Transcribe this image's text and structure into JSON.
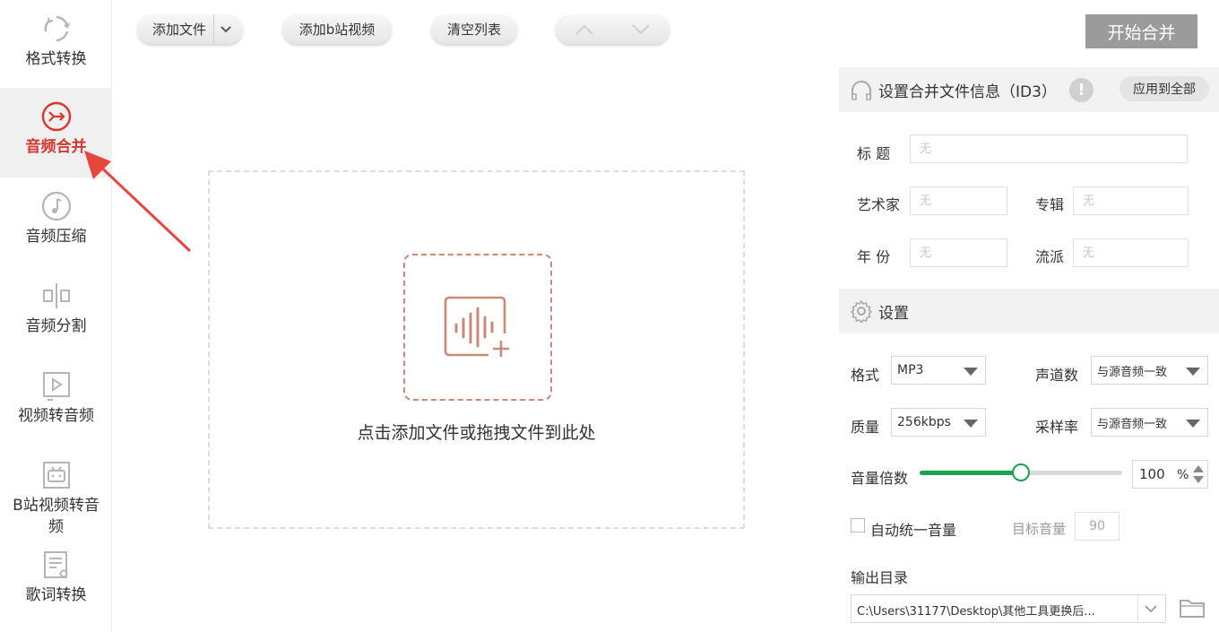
{
  "sidebar": {
    "items": [
      {
        "label": "格式转换",
        "icon": "refresh-icon"
      },
      {
        "label": "音频合并",
        "icon": "merge-icon",
        "active": true
      },
      {
        "label": "音频压缩",
        "icon": "music-note-icon"
      },
      {
        "label": "音频分割",
        "icon": "split-icon"
      },
      {
        "label": "视频转音频",
        "icon": "video-play-icon"
      },
      {
        "label": "B站视频转音频",
        "icon": "bilibili-tv-icon"
      },
      {
        "label": "歌词转换",
        "icon": "lyrics-file-icon"
      }
    ]
  },
  "toolbar": {
    "add_file": "添加文件",
    "add_bilibili": "添加b站视频",
    "clear_list": "清空列表",
    "start_merge": "开始合并"
  },
  "dropzone": {
    "hint": "点击添加文件或拖拽文件到此处"
  },
  "id3": {
    "title": "设置合并文件信息（ID3）",
    "apply_all": "应用到全部",
    "fields": {
      "title_label": "标  题",
      "artist_label": "艺术家",
      "album_label": "专辑",
      "year_label": "年  份",
      "genre_label": "流派",
      "placeholder": "无"
    }
  },
  "settings": {
    "title": "设置",
    "format_label": "格式",
    "format_value": "MP3",
    "channels_label": "声道数",
    "channels_value": "与源音频一致",
    "quality_label": "质量",
    "quality_value": "256kbps",
    "samplerate_label": "采样率",
    "samplerate_value": "与源音频一致",
    "volume_label": "音量倍数",
    "volume_value": "100",
    "volume_unit": "%",
    "volume_fraction": 0.5,
    "auto_volume_label": "自动统一音量",
    "target_volume_label": "目标音量",
    "target_volume_value": "90",
    "output_label": "输出目录",
    "output_path": "C:\\Users\\31177\\Desktop\\其他工具更换后..."
  },
  "colors": {
    "accent_red": "#d9362b",
    "slider_green": "#1aa34a",
    "drop_icon": "#c98a7a"
  }
}
